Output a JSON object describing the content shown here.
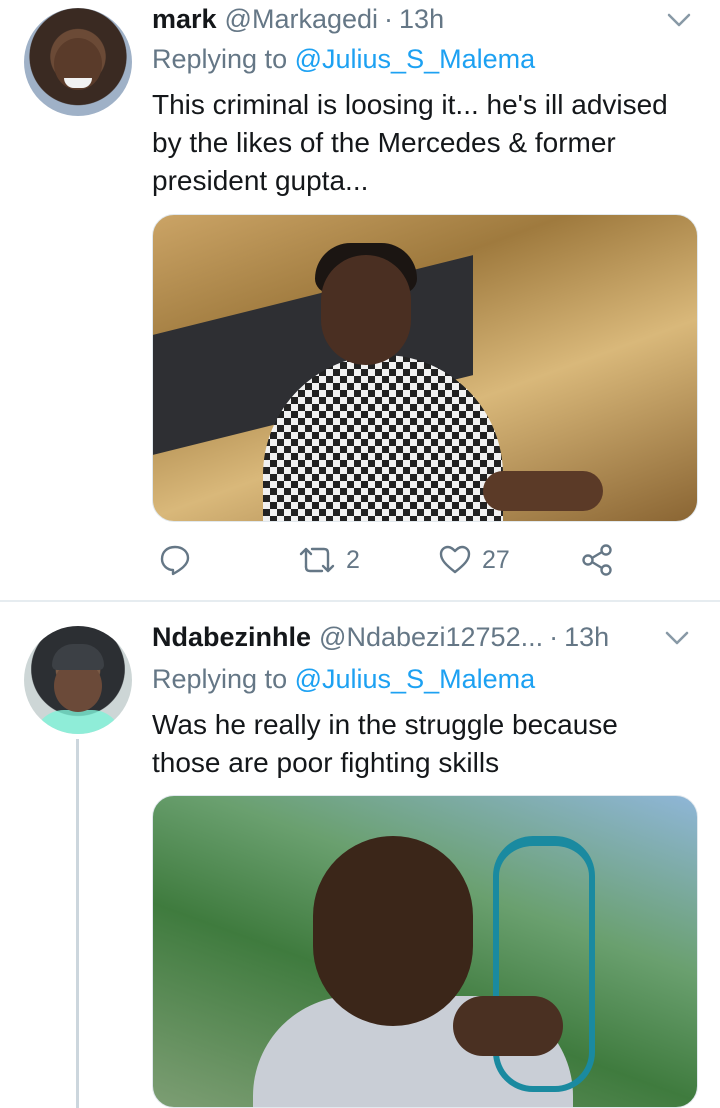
{
  "tweets": [
    {
      "name": "mark",
      "handle": "@Markagedi",
      "separator": "·",
      "time": "13h",
      "replying_prefix": "Replying to",
      "replying_to": "@Julius_S_Malema",
      "text": "This criminal is loosing it... he's ill advised by the likes of the Mercedes & former president gupta...",
      "retweets": "2",
      "likes": "27"
    },
    {
      "name": "Ndabezinhle",
      "handle": "@Ndabezi12752...",
      "separator": "·",
      "time": "13h",
      "replying_prefix": "Replying to",
      "replying_to": "@Julius_S_Malema",
      "text": "Was he really in the struggle because those are poor fighting skills"
    }
  ],
  "colors": {
    "link": "#1da1f2",
    "secondary": "#657786",
    "text": "#14171a",
    "thread_line": "#ccd6dd"
  },
  "icons": [
    "chevron-down-icon",
    "reply-icon",
    "retweet-icon",
    "like-icon",
    "share-icon"
  ]
}
